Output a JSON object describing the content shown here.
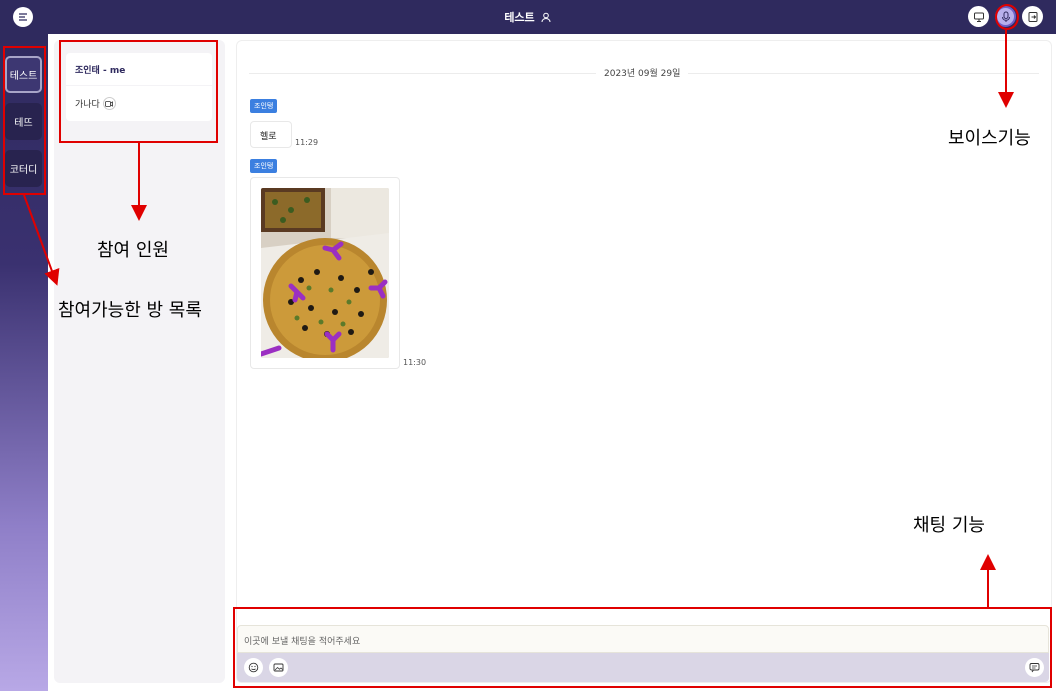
{
  "header": {
    "title": "테스트"
  },
  "rooms": [
    {
      "label": "테스트",
      "active": true
    },
    {
      "label": "테뜨",
      "active": false
    },
    {
      "label": "코터디",
      "active": false
    }
  ],
  "participants": {
    "me": "조인태 - me",
    "other": "가나다"
  },
  "chat": {
    "date": "2023년 09월 29일",
    "messages": [
      {
        "sender": "조인탱",
        "text": "헬로",
        "time": "11:29"
      },
      {
        "sender": "조인탱",
        "type": "image",
        "time": "11:30"
      }
    ]
  },
  "composer": {
    "placeholder": "이곳에 보낼 채팅을 적어주세요"
  },
  "annotations": {
    "voice": "보이스기능",
    "participants": "참여 인원",
    "rooms": "참여가능한 방 목록",
    "chat": "채팅 기능"
  },
  "colors": {
    "header": "#2f2a5e",
    "badge": "#3b7fe0",
    "annotation": "#e00000"
  }
}
